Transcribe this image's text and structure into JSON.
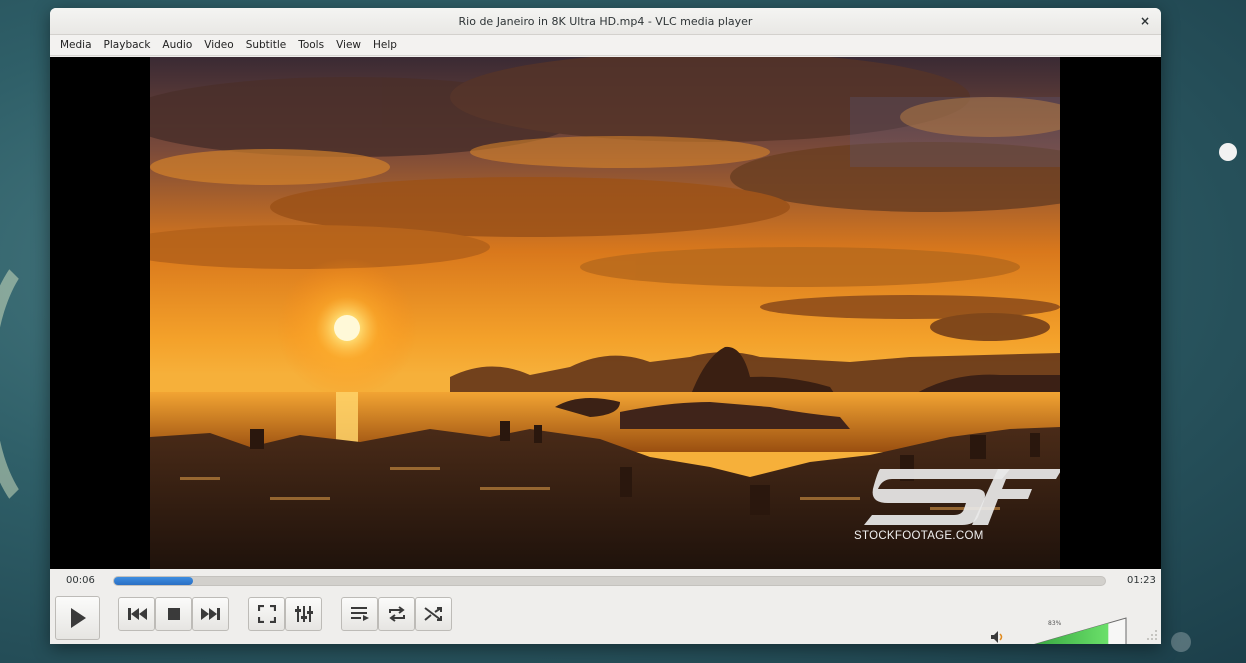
{
  "window": {
    "title": "Rio de Janeiro in 8K Ultra HD.mp4 - VLC media player",
    "close_glyph": "×"
  },
  "menu": [
    {
      "label": "Media"
    },
    {
      "label": "Playback"
    },
    {
      "label": "Audio"
    },
    {
      "label": "Video"
    },
    {
      "label": "Subtitle"
    },
    {
      "label": "Tools"
    },
    {
      "label": "View"
    },
    {
      "label": "Help"
    }
  ],
  "video": {
    "watermark_text": "STOCKFOOTAGE.COM",
    "watermark_logo": "SF"
  },
  "playback": {
    "elapsed": "00:06",
    "total": "01:23",
    "progress": 0.08
  },
  "controls": {
    "play": "play-icon",
    "previous": "skip-previous-icon",
    "stop": "stop-icon",
    "next": "skip-next-icon",
    "fullscreen": "fullscreen-icon",
    "extended": "equalizer-icon",
    "playlist": "playlist-icon",
    "loop": "loop-icon",
    "shuffle": "shuffle-icon"
  },
  "volume": {
    "label": "83%",
    "level": 0.83,
    "icon": "speaker-icon"
  },
  "colors": {
    "accent": "#2a6fc4",
    "volume_fill": "#3fc44a"
  }
}
